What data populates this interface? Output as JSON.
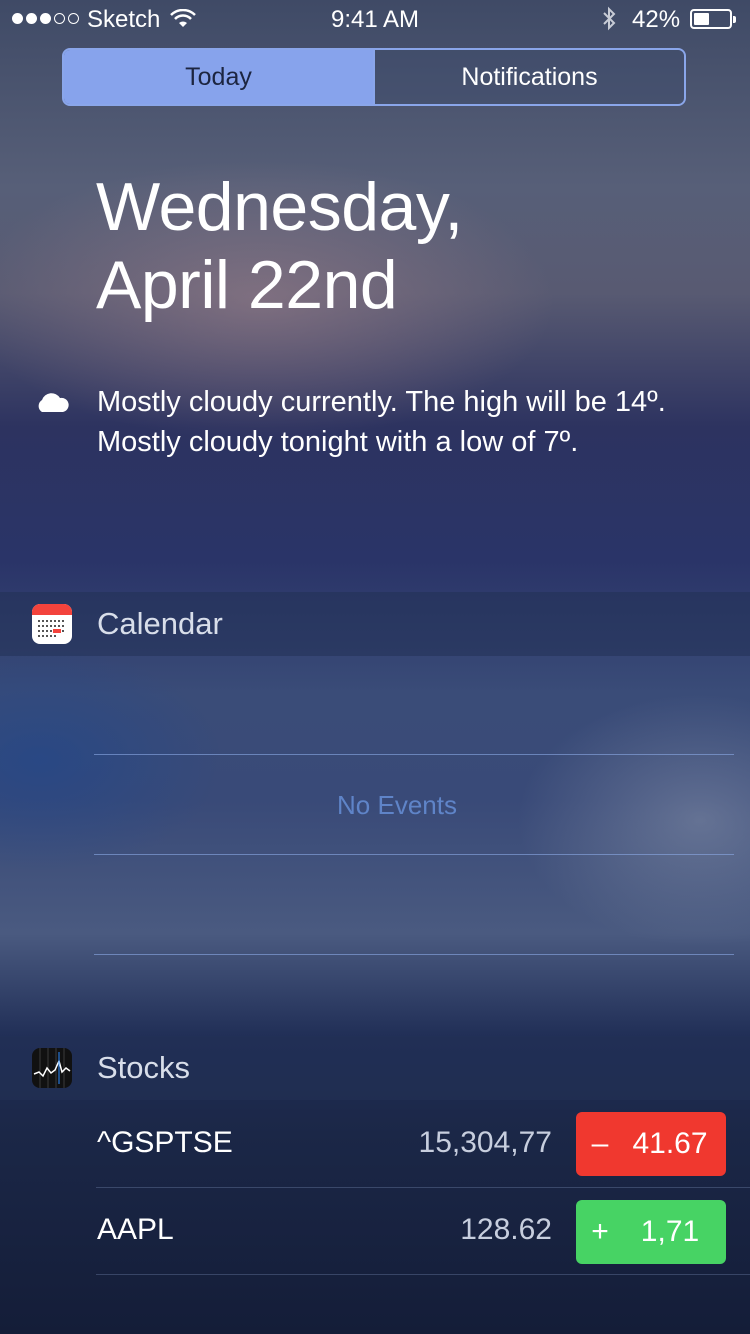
{
  "status_bar": {
    "carrier": "Sketch",
    "time": "9:41 AM",
    "battery_percent": "42%",
    "battery_level": 0.42,
    "signal_dots_filled": 3,
    "signal_dots_total": 5
  },
  "tabs": [
    {
      "label": "Today",
      "active": true
    },
    {
      "label": "Notifications",
      "active": false
    }
  ],
  "date": {
    "line1": "Wednesday,",
    "line2": "April 22nd"
  },
  "weather": {
    "icon": "cloud-icon",
    "summary": "Mostly cloudy currently. The high will be 14º. Mostly cloudy tonight with a low of 7º."
  },
  "calendar": {
    "title": "Calendar",
    "icon": "calendar-app-icon",
    "empty_text": "No Events"
  },
  "stocks": {
    "title": "Stocks",
    "icon": "stocks-app-icon",
    "rows": [
      {
        "symbol": "^GSPTSE",
        "price": "15,304,77",
        "sign": "–",
        "change": "41.67",
        "direction": "down"
      },
      {
        "symbol": "AAPL",
        "price": "128.62",
        "sign": "+",
        "change": "1,71",
        "direction": "up"
      }
    ]
  },
  "colors": {
    "accent": "#87a3ec",
    "down": "#f0382f",
    "up": "#47d364",
    "no_events": "#5f84c8"
  }
}
